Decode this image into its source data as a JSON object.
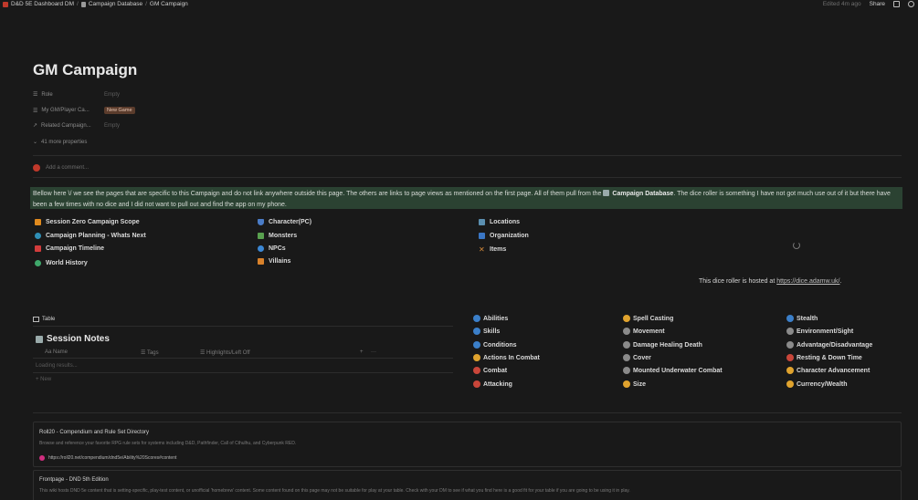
{
  "topbar": {
    "breadcrumbs": [
      "D&D 5E Dashboard DM",
      "Campaign Database",
      "GM Campaign"
    ],
    "edited": "Edited 4m ago",
    "share": "Share"
  },
  "page": {
    "title": "GM Campaign",
    "properties": [
      {
        "name": "Role",
        "value": "Empty"
      },
      {
        "name": "My GM/Player Ca...",
        "value": "New Game"
      },
      {
        "name": "Related Campaign...",
        "value": "Empty"
      }
    ],
    "more_properties": "41 more properties",
    "comment_placeholder": "Add a comment..."
  },
  "callout": {
    "text_before": "Bellow here \\/ we see the pages that are specific to this Campaign and do not link anywhere outside this page. The others are links to page views as mentioned on the first page. All of them pull from the ",
    "bold": "Campaign Database",
    "text_after": ". The dice roller is something I have not got much use out of it but there have been a few times with no dice and I did not want to pull out and find the app on my phone."
  },
  "links_col1": [
    "Session Zero Campaign Scope",
    "Campaign Planning - Whats Next",
    "Campaign Timeline",
    "World History"
  ],
  "links_col2": [
    "Character(PC)",
    "Monsters",
    "NPCs",
    "Villains"
  ],
  "links_col3": [
    "Locations",
    "Organization",
    "Items"
  ],
  "dice": {
    "text": "This dice roller is hosted at ",
    "url": "https://dice.adamw.uk/",
    "suffix": "."
  },
  "table_view": {
    "tab_label": "Table",
    "db_title": "Session Notes",
    "columns": [
      "Aa Name",
      "Tags",
      "Highlights/Left Off"
    ],
    "loading": "Loading results...",
    "new": "+ New",
    "add": "+",
    "more": "···"
  },
  "rules_col1": [
    "Abilities",
    "Skills",
    "Conditions",
    "Actions In Combat",
    "Combat",
    "Attacking"
  ],
  "rules_col2": [
    "Spell Casting",
    "Movement",
    "Damage Healing Death",
    "Cover",
    "Mounted Underwater Combat",
    "Size"
  ],
  "rules_col3": [
    "Stealth",
    "Environment/Sight",
    "Advantage/Disadvantage",
    "Resting & Down Time",
    "Character Advancement",
    "Currency/Wealth"
  ],
  "bookmarks": [
    {
      "title": "Roll20 - Compendium and Rule Set Directory",
      "desc": "Browse and reference your favorite RPG rule sets for systems including D&D, Pathfinder, Call of Cthulhu, and Cyberpunk RED.",
      "url": "https://roll20.net/compendium/dnd5e/Ability%20Scores#content"
    },
    {
      "title": "Frontpage - DND 5th Edition",
      "desc": "This wiki hosts DND 5e content that is setting-specific, play-test content, or unofficial 'homebrew' content. Some content found on this page may not be suitable for play at your table. Check with your DM to see if what you find here is a good fit for your table if you are going to be using it in play."
    }
  ]
}
